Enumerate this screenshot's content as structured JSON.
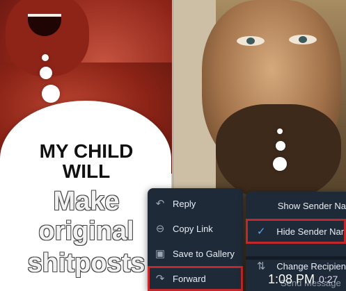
{
  "meme": {
    "line1": "MY CHILD",
    "line2": "WILL",
    "line3": "Make",
    "line4": "original",
    "line5": "shitposts"
  },
  "context_menu": {
    "items": [
      {
        "label": "Reply",
        "icon": "reply-icon"
      },
      {
        "label": "Copy Link",
        "icon": "link-icon"
      },
      {
        "label": "Save to Gallery",
        "icon": "gallery-icon"
      },
      {
        "label": "Forward",
        "icon": "forward-icon"
      }
    ]
  },
  "options_menu": {
    "items": [
      {
        "label": "Show Sender Na",
        "icon": ""
      },
      {
        "label": "Hide Sender Nan",
        "icon": "checkmark-icon"
      },
      {
        "label": "Change Recipien",
        "icon": "recipients-icon"
      },
      {
        "label": "Send Message",
        "icon": ""
      }
    ]
  },
  "status": {
    "time": "1:08 PM",
    "duration": "0:27"
  },
  "colors": {
    "menu_bg": "#1f2a38",
    "highlight": "#c0282b",
    "accent": "#5aa7e8"
  }
}
